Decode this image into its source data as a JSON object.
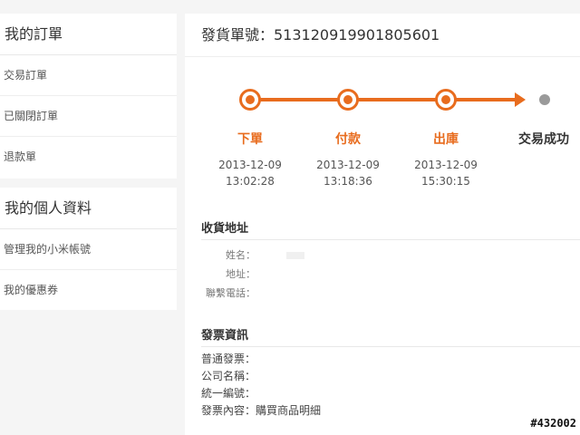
{
  "breadcrumb": "",
  "sidebar": {
    "orders": {
      "title": "我的訂單",
      "items": [
        "交易訂單",
        "已關閉訂單",
        "退款單"
      ]
    },
    "profile": {
      "title": "我的個人資料",
      "items": [
        "管理我的小米帳號",
        "我的優惠券"
      ]
    }
  },
  "order": {
    "title": "發貨單號：513120919901805601",
    "steps": [
      {
        "label": "下單",
        "date": "2013-12-09",
        "time": "13:02:28"
      },
      {
        "label": "付款",
        "date": "2013-12-09",
        "time": "13:18:36"
      },
      {
        "label": "出庫",
        "date": "2013-12-09",
        "time": "15:30:15"
      },
      {
        "label": "交易成功",
        "date": "",
        "time": ""
      }
    ],
    "accent_color": "#e86c1e",
    "pending_color": "#9a9a9a"
  },
  "address": {
    "title": "收貨地址",
    "rows": [
      {
        "key": "姓名："
      },
      {
        "key": "地址："
      },
      {
        "key": "聯繫電話："
      }
    ]
  },
  "invoice": {
    "title": "發票資訊",
    "rows": [
      {
        "text": "普通發票："
      },
      {
        "text": "公司名稱："
      },
      {
        "text": "統一編號："
      },
      {
        "text": "發票內容：購買商品明細"
      }
    ]
  },
  "watermark": "#432002"
}
